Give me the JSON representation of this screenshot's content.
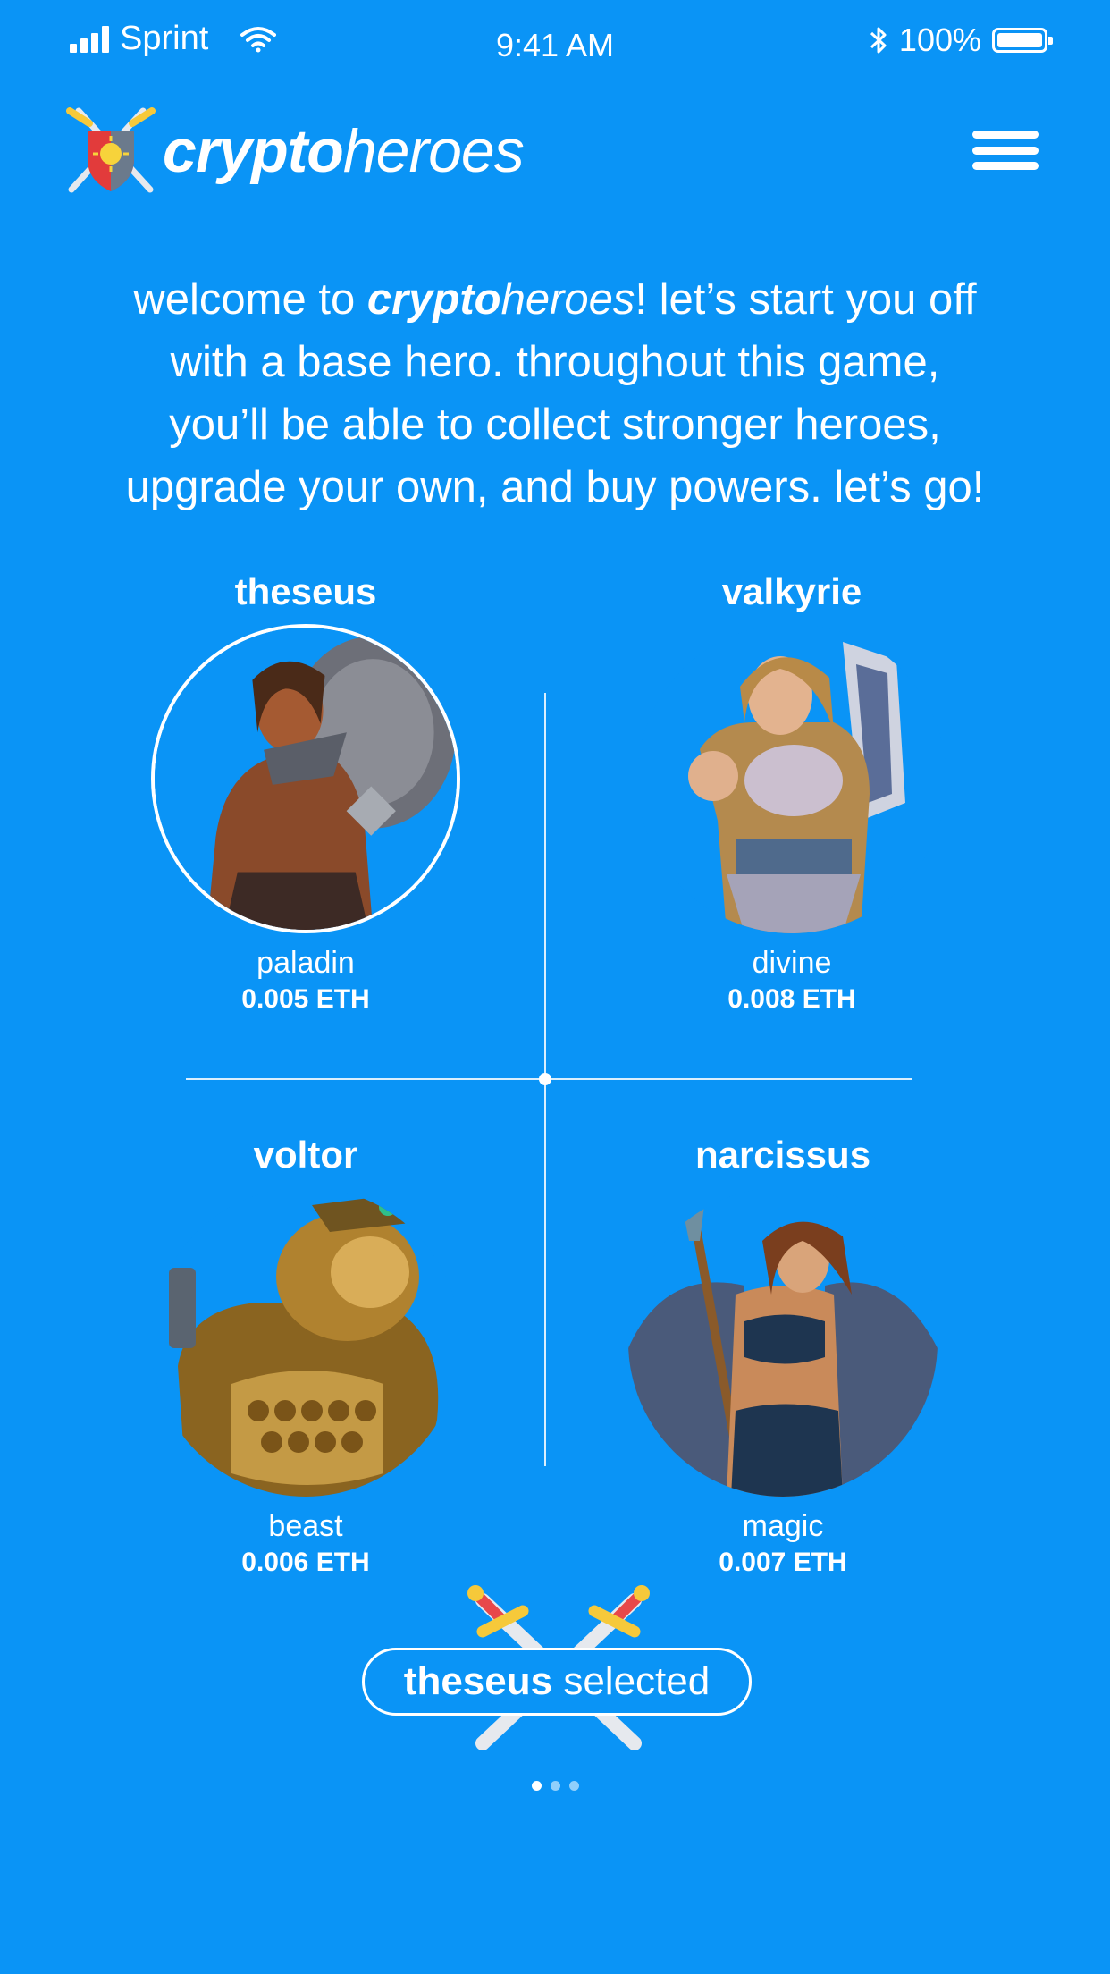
{
  "status_bar": {
    "carrier": "Sprint",
    "time": "9:41 AM",
    "battery": "100%",
    "icons": [
      "signal-icon",
      "wifi-icon",
      "bluetooth-icon",
      "battery-icon"
    ]
  },
  "header": {
    "logo_bold": "crypto",
    "logo_regular": "heroes",
    "menu_icon": "hamburger-menu-icon"
  },
  "intro": {
    "part1": "welcome to ",
    "brand_bold": "crypto",
    "brand_italic": "heroes",
    "part2": "! let’s start you off with a base hero. throughout this game, you’ll be able to collect stronger heroes, upgrade your own, and buy powers. let’s go!"
  },
  "heroes": [
    {
      "name": "theseus",
      "class": "paladin",
      "price": "0.005 ETH",
      "selected": true
    },
    {
      "name": "valkyrie",
      "class": "divine",
      "price": "0.008 ETH",
      "selected": false
    },
    {
      "name": "voltor",
      "class": "beast",
      "price": "0.006 ETH",
      "selected": false
    },
    {
      "name": "narcissus",
      "class": "magic",
      "price": "0.007 ETH",
      "selected": false
    }
  ],
  "selection": {
    "hero_name": "theseus",
    "label": " selected"
  },
  "pagination": {
    "total": 3,
    "active": 1
  },
  "colors": {
    "background": "#0a94f6",
    "text": "#ffffff",
    "sword_hilt_yellow": "#f6c93a",
    "sword_hilt_red": "#e8484a",
    "shield_red": "#e23b3b",
    "sun_yellow": "#f7d33b"
  }
}
